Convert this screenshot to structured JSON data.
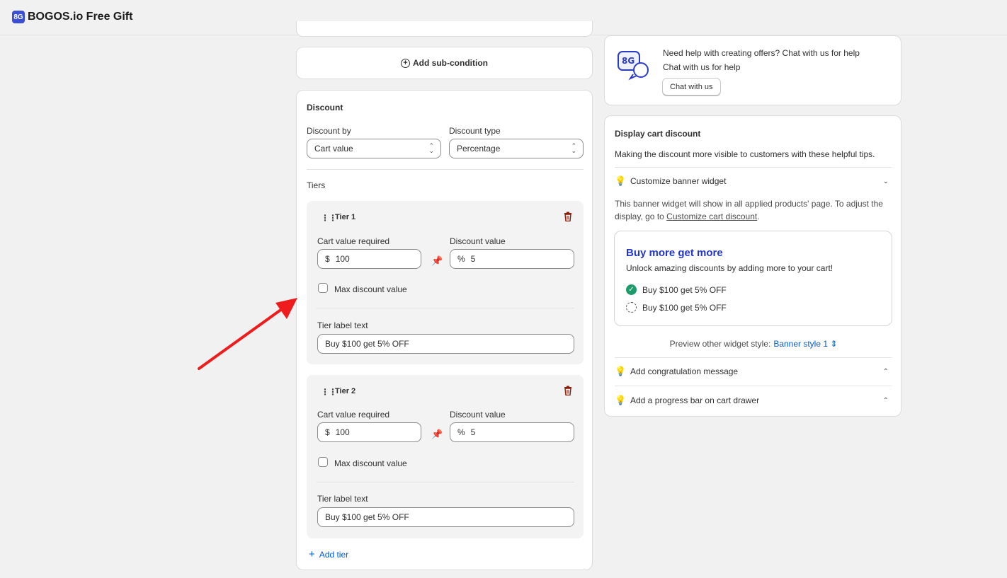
{
  "app": {
    "title": "BOGOS.io Free Gift",
    "logo_text": "8G"
  },
  "subcondition": {
    "label": "Add sub-condition"
  },
  "discount": {
    "title": "Discount",
    "discount_by_label": "Discount by",
    "discount_by_value": "Cart value",
    "discount_type_label": "Discount type",
    "discount_type_value": "Percentage",
    "tiers_label": "Tiers",
    "tiers": [
      {
        "name": "Tier 1",
        "cart_value_label": "Cart value required",
        "currency": "$",
        "cart_value": "100",
        "discount_value_label": "Discount value",
        "percent": "%",
        "discount_value": "5",
        "max_discount_label": "Max discount value",
        "max_discount_checked": false,
        "label_text_label": "Tier label text",
        "label_text": "Buy $100 get 5% OFF"
      },
      {
        "name": "Tier 2",
        "cart_value_label": "Cart value required",
        "currency": "$",
        "cart_value": "100",
        "discount_value_label": "Discount value",
        "percent": "%",
        "discount_value": "5",
        "max_discount_label": "Max discount value",
        "max_discount_checked": false,
        "label_text_label": "Tier label text",
        "label_text": "Buy $100 get 5% OFF"
      }
    ],
    "add_tier_label": "Add tier"
  },
  "help": {
    "line1": "Need help with creating offers? Chat with us for help",
    "line2": "Chat with us for help",
    "button_label": "Chat with us"
  },
  "display": {
    "title": "Display cart discount",
    "description": "Making the discount more visible to customers with these helpful tips.",
    "customize_banner_label": "Customize banner widget",
    "banner_info_prefix": "This banner widget will show in all applied products' page. To adjust the display, go to ",
    "banner_info_link": "Customize cart discount",
    "banner_info_suffix": ".",
    "banner": {
      "title": "Buy more get more",
      "subtitle": "Unlock amazing discounts by adding more to your cart!",
      "items": [
        "Buy $100 get 5% OFF",
        "Buy $100 get 5% OFF"
      ]
    },
    "preview_label": "Preview other widget style:",
    "preview_value": "Banner style 1",
    "congrats_label": "Add congratulation message",
    "progress_label": "Add a progress bar on cart drawer"
  },
  "colors": {
    "accent": "#005bd3",
    "brand": "#3a4fd4",
    "banner_title": "#2135c9",
    "danger": "#8e1f0b",
    "success": "#1f9a6a",
    "annotation_arrow": "#ee1c1c"
  }
}
